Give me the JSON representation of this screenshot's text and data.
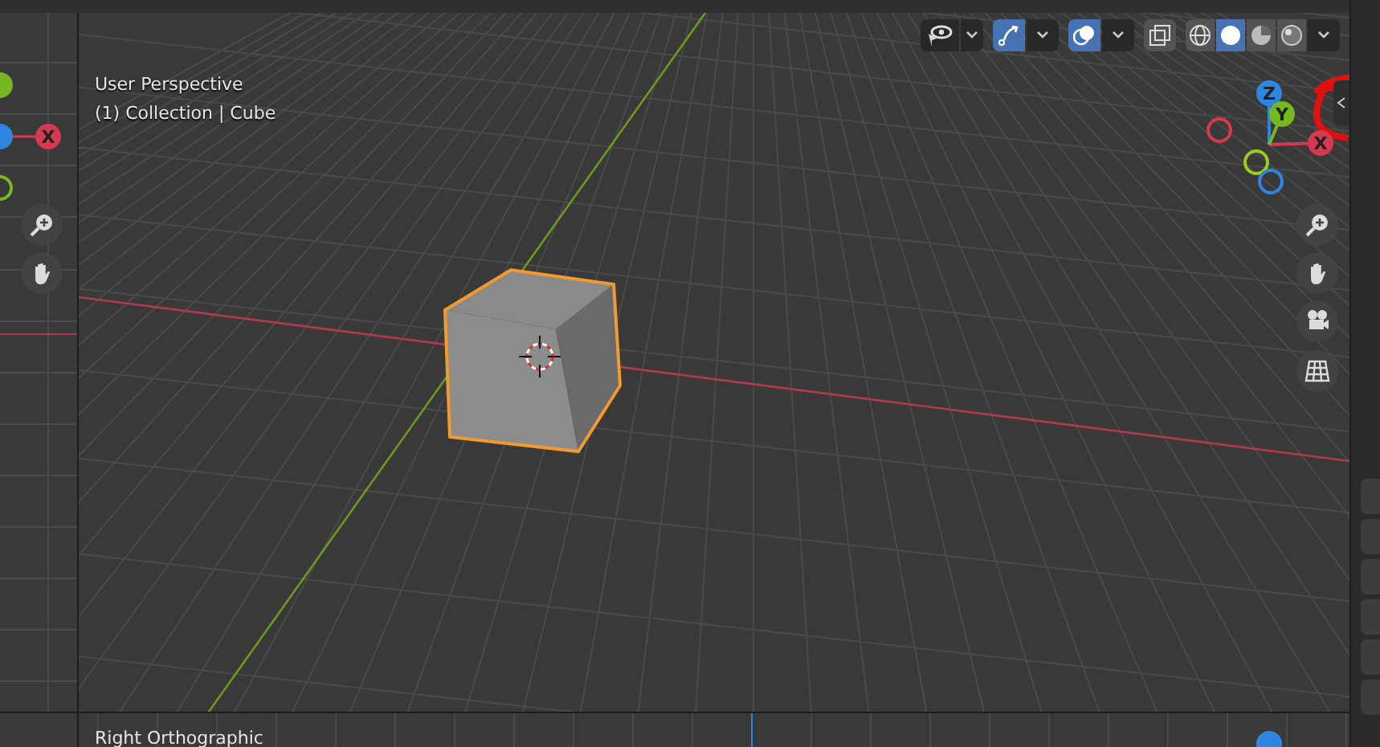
{
  "viewport": {
    "view_name": "User Perspective",
    "object_info": "(1) Collection | Cube",
    "header": {
      "gizmos_on": true,
      "overlays_on": true,
      "xray_on": false,
      "shading_modes": [
        {
          "kind": "wireframe",
          "selected": false
        },
        {
          "kind": "solid",
          "selected": true
        },
        {
          "kind": "material",
          "selected": false
        },
        {
          "kind": "rendered",
          "selected": false
        }
      ]
    },
    "gizmo": {
      "x": "X",
      "y": "Y",
      "z": "Z"
    }
  },
  "left_viewport": {
    "gizmo_x": "X"
  },
  "bottom_viewport": {
    "view_name": "Right Orthographic"
  }
}
